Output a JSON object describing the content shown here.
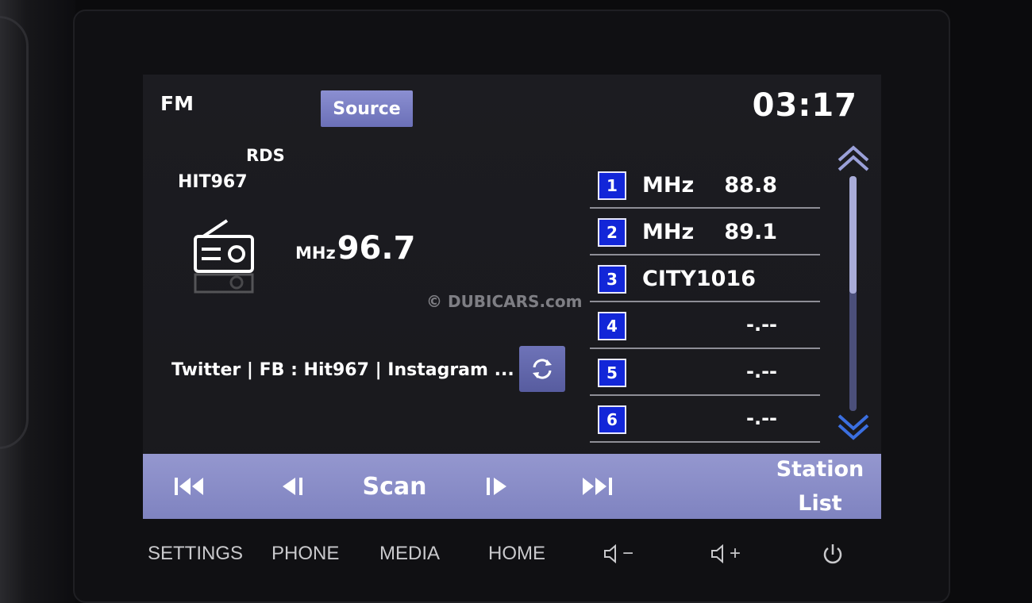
{
  "header": {
    "band": "FM",
    "source_label": "Source",
    "clock": "03:17"
  },
  "now_playing": {
    "rds_label": "RDS",
    "station_name": "HIT967",
    "frequency_unit": "MHz",
    "frequency": "96.7",
    "radio_text": "Twitter | FB : Hit967 | Instagram ..."
  },
  "watermark": "© DUBICARS.com",
  "presets": [
    {
      "number": "1",
      "unit": "MHz",
      "value": "88.8",
      "name": ""
    },
    {
      "number": "2",
      "unit": "MHz",
      "value": "89.1",
      "name": ""
    },
    {
      "number": "3",
      "unit": "",
      "value": "",
      "name": "CITY1016"
    },
    {
      "number": "4",
      "unit": "",
      "value": "-.--",
      "name": ""
    },
    {
      "number": "5",
      "unit": "",
      "value": "-.--",
      "name": ""
    },
    {
      "number": "6",
      "unit": "",
      "value": "-.--",
      "name": ""
    }
  ],
  "controls": {
    "scan_label": "Scan",
    "station_list_line1": "Station",
    "station_list_line2": "List"
  },
  "hardware_buttons": {
    "settings": "SETTINGS",
    "phone": "PHONE",
    "media": "MEDIA",
    "home": "HOME",
    "vol_down": "−",
    "vol_up": "+"
  },
  "colors": {
    "screen_bg": "#1c1c21",
    "accent_button": "#7f83c0",
    "preset_badge": "#1226d8",
    "scroll_arrow": "#3b6fe0"
  }
}
